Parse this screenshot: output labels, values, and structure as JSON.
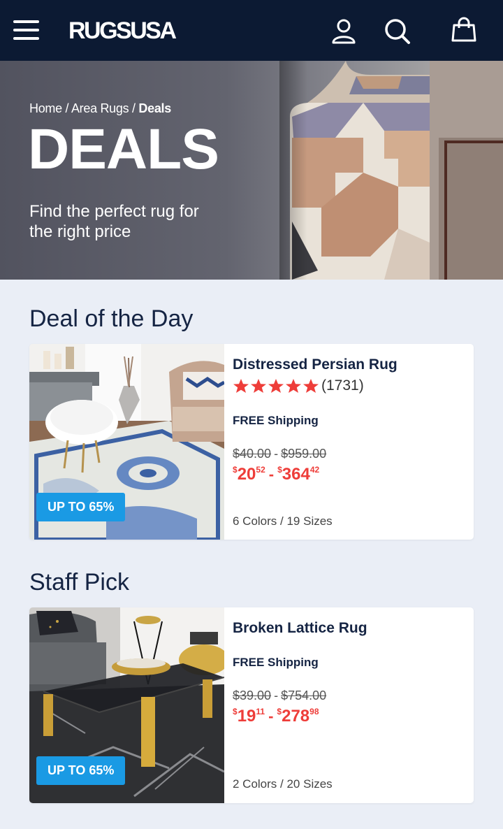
{
  "header": {
    "brand_part1": "RUGS",
    "brand_part2": "USA",
    "icons": [
      "menu-icon",
      "user-icon",
      "search-icon",
      "bag-icon"
    ]
  },
  "hero": {
    "breadcrumb": [
      "Home",
      "Area Rugs",
      "Deals"
    ],
    "title": "DEALS",
    "subtitle": "Find the perfect rug for the right price"
  },
  "sections": [
    {
      "title": "Deal of the Day",
      "product": {
        "name": "Distressed Persian Rug",
        "rating_stars": 5,
        "rating_count": "(1731)",
        "shipping": "FREE Shipping",
        "old_price_low": "$40.00",
        "old_price_high": "$959.00",
        "sale_low_dollars": "20",
        "sale_low_cents": "52",
        "sale_high_dollars": "364",
        "sale_high_cents": "42",
        "currency_symbol": "$",
        "variants": "6 Colors / 19 Sizes",
        "badge": "UP TO 65%"
      }
    },
    {
      "title": "Staff Pick",
      "product": {
        "name": "Broken Lattice Rug",
        "shipping": "FREE Shipping",
        "old_price_low": "$39.00",
        "old_price_high": "$754.00",
        "sale_low_dollars": "19",
        "sale_low_cents": "11",
        "sale_high_dollars": "278",
        "sale_high_cents": "98",
        "currency_symbol": "$",
        "variants": "2 Colors / 20 Sizes",
        "badge": "UP TO 65%"
      }
    }
  ],
  "colors": {
    "header_bg": "#0c1a33",
    "page_bg": "#eaeef6",
    "badge_bg": "#1a9ae4",
    "sale_price": "#ee3d39",
    "star": "#ee3d39",
    "text_dark": "#152443"
  },
  "separators": {
    "breadcrumb": "/",
    "price_range": "-"
  }
}
